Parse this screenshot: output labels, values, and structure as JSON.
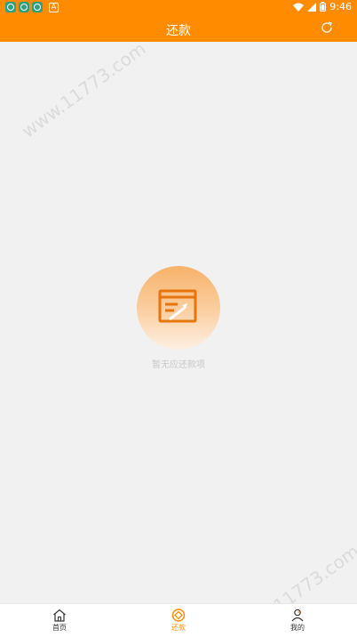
{
  "status_bar": {
    "time": "9:46",
    "left_badge_letter": "A",
    "icons": [
      "app-icon",
      "app-icon",
      "app-icon",
      "a-icon",
      "wifi-icon",
      "signal-icon",
      "battery-icon"
    ]
  },
  "nav": {
    "title": "还款",
    "refresh_icon": "refresh-icon"
  },
  "empty_state": {
    "message": "暂无应还款项",
    "icon": "document-edit-icon"
  },
  "watermark": {
    "text": "www.11773.com"
  },
  "tabs": [
    {
      "label": "首页",
      "icon": "home-icon",
      "active": false
    },
    {
      "label": "还款",
      "icon": "repay-icon",
      "active": true
    },
    {
      "label": "我的",
      "icon": "person-icon",
      "active": false
    }
  ],
  "colors": {
    "primary": "#ff8c00",
    "background": "#f1f1f1",
    "tab_inactive": "#333333"
  }
}
